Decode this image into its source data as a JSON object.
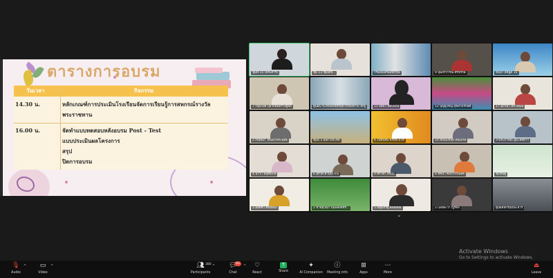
{
  "slide": {
    "title": "ตารางการอบรม",
    "header": {
      "time_col": "วันเวลา",
      "activity_col": "กิจกรรม"
    },
    "rows": [
      {
        "time": "14.30 น.",
        "lines": [
          "หลักเกณฑ์การประเมินโรงเรียนจัดการเรียนรู้การสหกรณ์รางวัล",
          "พระราชทาน"
        ]
      },
      {
        "time": "16.00 น.",
        "lines": [
          "จัดทำแบบทดสอบหลังอบรม  Post - Test",
          "แบบประเมินผลโครงการ",
          "สรุป",
          "ปิดการอบรม"
        ]
      }
    ]
  },
  "gallery": {
    "tiles": [
      {
        "name": "ชุมมี-15 (พระตำรี)"
      },
      {
        "name": "ชุม 13 ชุ่มเตช..."
      },
      {
        "name": "กรมส่งเสริมสหกรณ์"
      },
      {
        "name": "9 บุษภรวารณ์ ศรีจิรักษ์"
      },
      {
        "name": "จันนา สหมู่ดิ 15"
      },
      {
        "name": "7 กนุ้ยวงศ์ ปลวิกิตมิตรวงศูลย์"
      },
      {
        "name": "ศูนย์ป ระทรงสิงห์ทรัพยากรตั้งหาระวัดชู่"
      },
      {
        "name": "11 อิสมา มีดะนาม"
      },
      {
        "name": "12 บุญคู่ใหญ่ สุขสามรักษ์ดี"
      },
      {
        "name": "17 สุภัวพา ลิจาบพณ์"
      },
      {
        "name": "2 กฤษณา ใหนมาพระพุทธ"
      },
      {
        "name": "ชุมมิ 5 ผลงานระห์ต"
      },
      {
        "name": "6 ไป่ทับสัน ทรงทะบวท"
      },
      {
        "name": "10 สมณะศฤติ สนิเลิกษ์"
      },
      {
        "name": "3-ประภาพิณ สู่มะลัตดิวา"
      },
      {
        "name": "4 นาวา พฤศจิเกย์"
      },
      {
        "name": "6 สุรัวดี คานปะมณ"
      },
      {
        "name": "4 ศิราตา สร้อมิ"
      },
      {
        "name": "8 ทัศนา ศิลปิวรรณคดี"
      },
      {
        "name": "ชุมชันคู"
      },
      {
        "name": "3 ลลิตศา ศิลปีทอง"
      },
      {
        "name": "2 ชายสุวณา ณเพลิงพชร์..."
      },
      {
        "name": "5 ณัฐพรรฐ์ ศักดิ์สิทธิ์"
      },
      {
        "name": "2 แสงตะวา ญูร์ตอ"
      },
      {
        "name": "ศูนย์สหกรณ์ปั๊บะจำร์"
      }
    ]
  },
  "toolbar": {
    "audio": "Audio",
    "video": "Video",
    "participants": "Participants",
    "participants_count": "380",
    "chat": "Chat",
    "chat_badge": "93",
    "react": "React",
    "share": "Share",
    "ai_companion": "AI Companion",
    "meeting_info": "Meeting info",
    "apps": "Apps",
    "more": "More",
    "leave": "Leave"
  },
  "watermark": {
    "line1": "Activate Windows",
    "line2": "Go to Settings to activate Windows."
  },
  "colors": {
    "accent_green": "#1fae5b",
    "badge_red": "#e5453a",
    "slide_header": "#f6c24d"
  }
}
